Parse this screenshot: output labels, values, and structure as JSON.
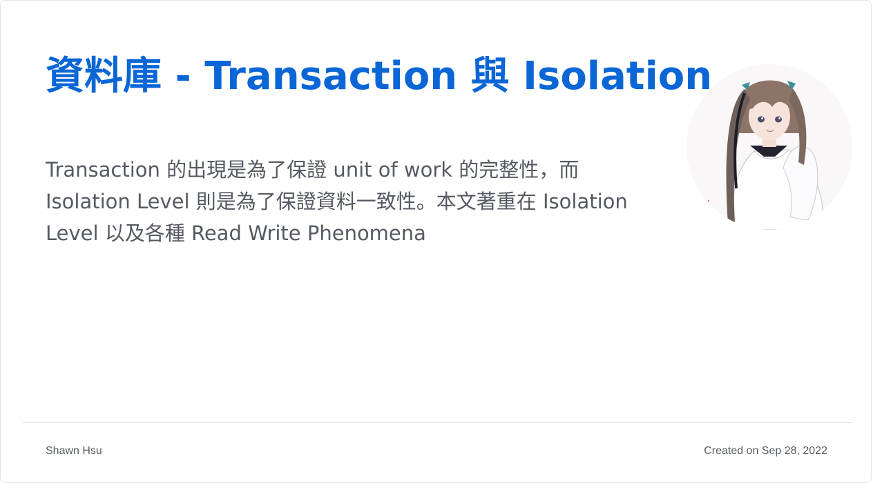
{
  "post": {
    "title": "資料庫 - Transaction 與 Isolation",
    "description": "Transaction 的出現是為了保證 unit of work 的完整性，而 Isolation Level 則是為了保證資料一致性。本文著重在 Isolation Level 以及各種 Read Write Phenomena",
    "author": "Shawn Hsu",
    "created": "Created on Sep 28, 2022"
  },
  "avatar": {
    "icon": "anime-girl-avatar-icon"
  },
  "colors": {
    "title": "#0a66d6",
    "text": "#555a62",
    "divider": "#e5e5e5",
    "avatar_bg": "#f9f7f7"
  }
}
